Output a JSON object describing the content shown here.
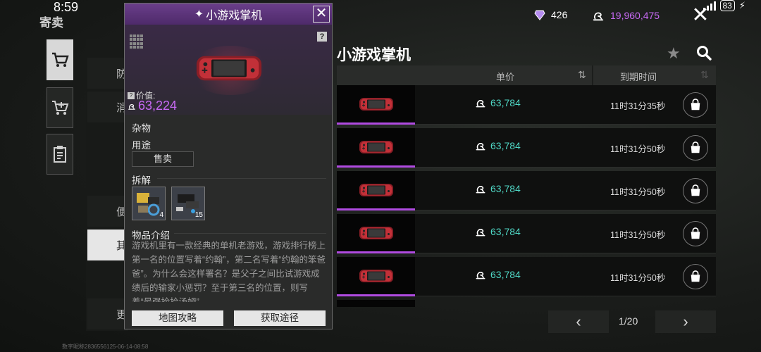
{
  "status_bar": {
    "time": "8:59",
    "battery": "83"
  },
  "page": {
    "title": "寄卖"
  },
  "currency": {
    "gems": "426",
    "coins": "19,960,475",
    "gem_color": "#b58cf0",
    "coin_color": "#c86af5"
  },
  "left_rail": {
    "icons": [
      "shopping-cart-icon",
      "cart-add-icon",
      "clipboard-icon"
    ]
  },
  "category_list": {
    "items": [
      "防",
      "消",
      "便",
      "其",
      "更"
    ]
  },
  "listing": {
    "title": "小游戏掌机",
    "columns": {
      "price": "单价",
      "expire": "到期时间"
    },
    "rows": [
      {
        "price": "63,784",
        "time": "11时31分35秒"
      },
      {
        "price": "63,784",
        "time": "11时31分50秒"
      },
      {
        "price": "63,784",
        "time": "11时31分50秒"
      },
      {
        "price": "63,784",
        "time": "11时31分50秒"
      },
      {
        "price": "63,784",
        "time": "11时31分50秒"
      }
    ],
    "pager": "1/20",
    "price_color": "#4fd6c4",
    "rarity_color": "#b04be0"
  },
  "popup": {
    "title": "小游戏掌机",
    "value_label": "价值:",
    "value": "63,224",
    "category": "杂物",
    "usage_heading": "用途",
    "usage_value": "售卖",
    "dismantle_heading": "拆解",
    "components": [
      {
        "icon": "parts-bundle-icon",
        "count": "4"
      },
      {
        "icon": "electronics-bundle-icon",
        "count": "15"
      }
    ],
    "desc_heading": "物品介绍",
    "description": "游戏机里有一款经典的单机老游戏，游戏排行榜上第一名的位置写着“约翰”，第二名写着“约翰的笨爸爸”。为什么会这样署名？是父子之间比试游戏成绩后的输家小惩罚？至于第三名的位置，则写着“最强捡拾汤姆”",
    "map_button": "地图攻略",
    "source_button": "获取途径"
  },
  "watermark": "数字昵称2836556125-06-14-08:58"
}
